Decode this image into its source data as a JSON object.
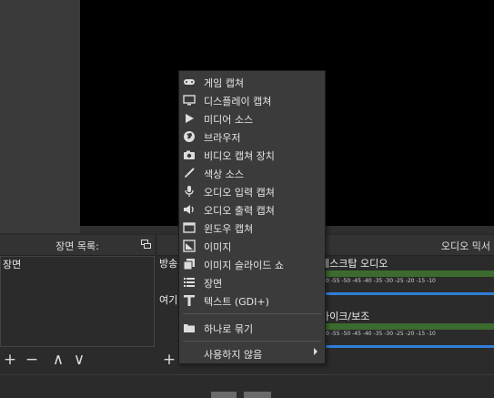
{
  "scenes": {
    "title": "장면 목록:",
    "items": [
      "장면"
    ]
  },
  "sources": {
    "items": [
      "방송",
      "여기"
    ]
  },
  "mixer": {
    "title": "오디오 믹서",
    "channels": [
      {
        "label": "데스크탑 오디오",
        "ticks": "-60 -55 -50 -45 -40 -35 -30 -25 -20 -15 -10"
      },
      {
        "label": "마이크/보조",
        "ticks": "-60 -55 -50 -45 -40 -35 -30 -25 -20 -15 -10"
      }
    ]
  },
  "toolbar": {
    "add": "+",
    "remove": "−",
    "up": "∧",
    "down": "∨"
  },
  "menu": {
    "items": [
      {
        "label": "게임 캡쳐",
        "icon": "gamepad-icon"
      },
      {
        "label": "디스플레이 캡쳐",
        "icon": "monitor-icon"
      },
      {
        "label": "미디어 소스",
        "icon": "play-icon"
      },
      {
        "label": "브라우저",
        "icon": "globe-icon"
      },
      {
        "label": "비디오 캡쳐 장치",
        "icon": "camera-icon"
      },
      {
        "label": "색상 소스",
        "icon": "brush-icon"
      },
      {
        "label": "오디오 입력 캡쳐",
        "icon": "microphone-icon"
      },
      {
        "label": "오디오 출력 캡쳐",
        "icon": "speaker-icon"
      },
      {
        "label": "윈도우 캡쳐",
        "icon": "window-icon"
      },
      {
        "label": "이미지",
        "icon": "image-icon"
      },
      {
        "label": "이미지 슬라이드 쇼",
        "icon": "slideshow-icon"
      },
      {
        "label": "장면",
        "icon": "list-icon"
      },
      {
        "label": "텍스트 (GDI+)",
        "icon": "text-icon"
      }
    ],
    "group": {
      "label": "하나로 묶기",
      "icon": "folder-icon"
    },
    "deprecated": {
      "label": "사용하지 않음"
    }
  },
  "colors": {
    "meter_green": "#3b6b2e",
    "slider_blue": "#2f7fd8",
    "menu_bg": "#3b3b3b"
  }
}
